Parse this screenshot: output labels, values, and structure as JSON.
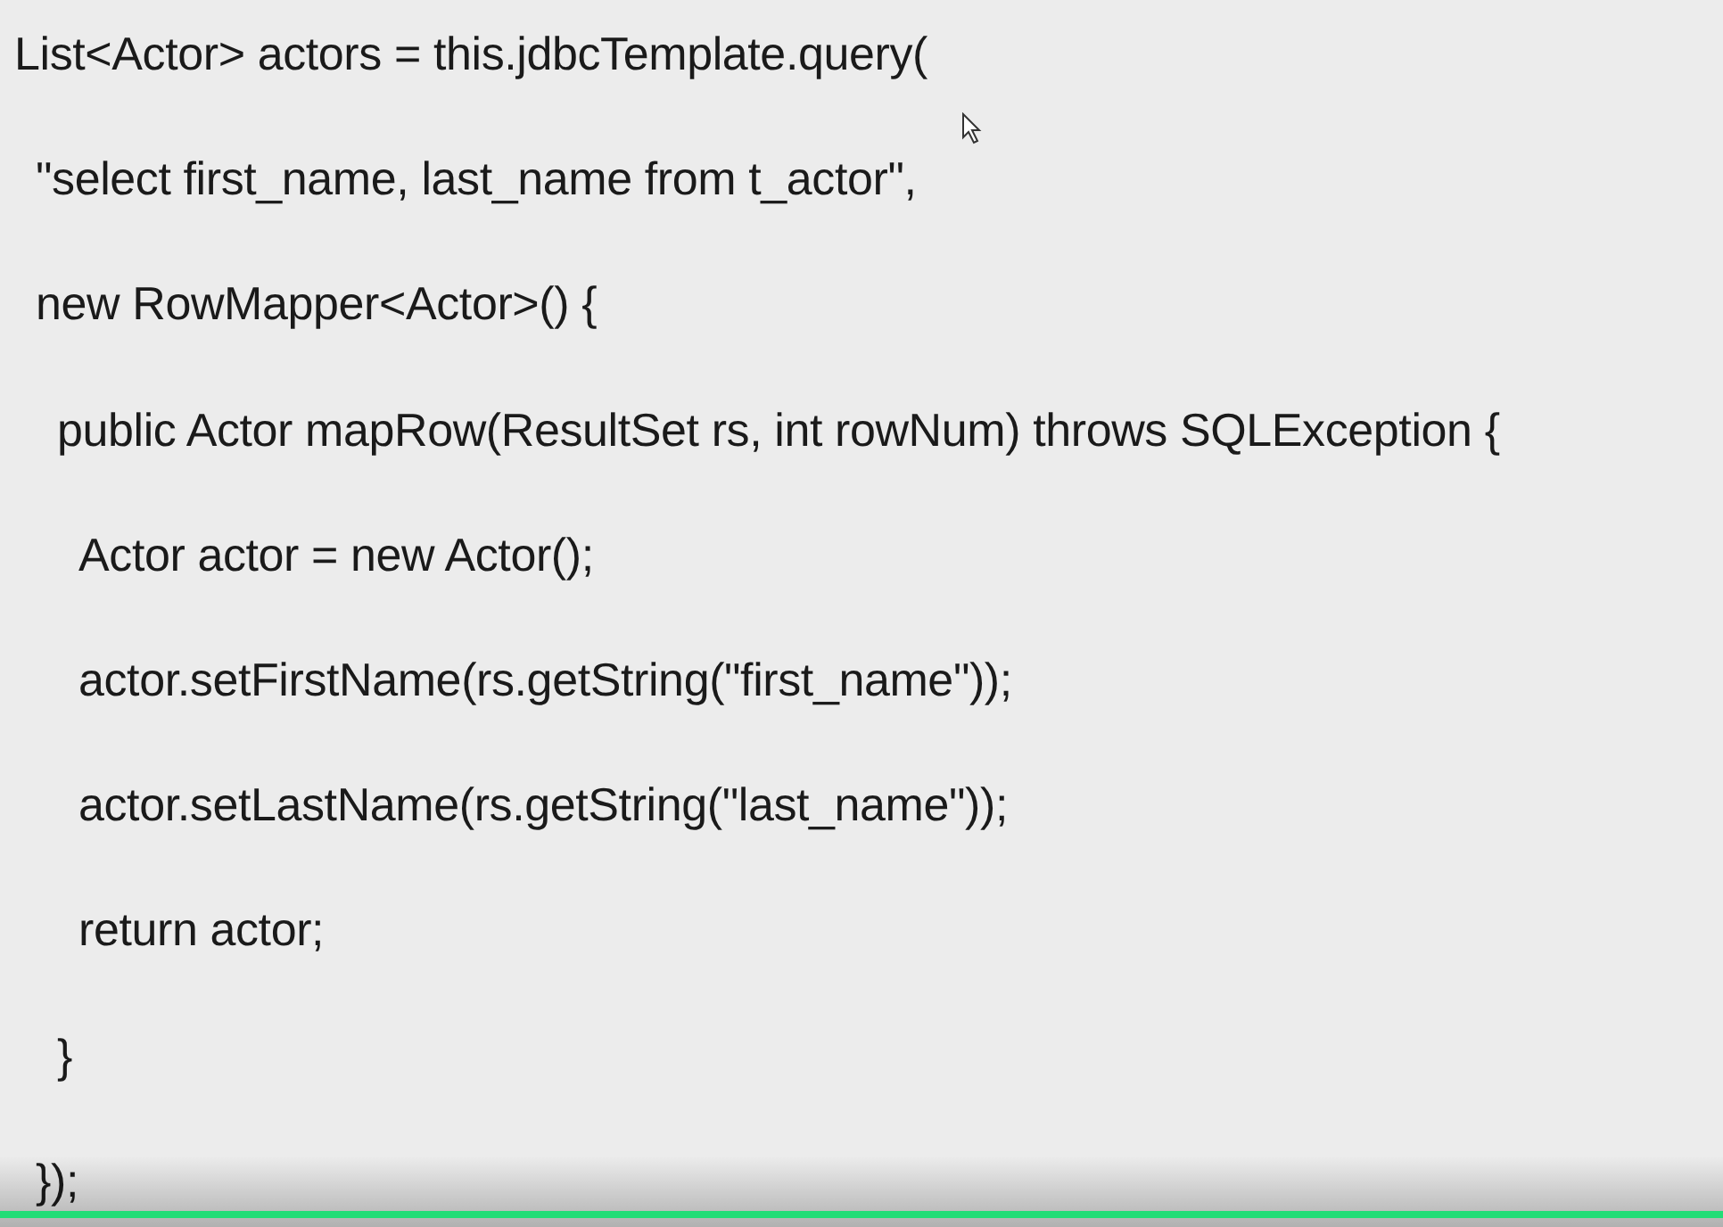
{
  "code": [
    {
      "text": "List<Actor> actors = this.jdbcTemplate.query(",
      "children": [
        {
          "text": "\"select first_name, last_name from t_actor\","
        },
        {
          "text": "new RowMapper<Actor>() {",
          "children": [
            {
              "text": "public Actor mapRow(ResultSet rs, int rowNum) throws SQLException {",
              "children": [
                {
                  "text": "Actor actor = new Actor();"
                },
                {
                  "text": "actor.setFirstName(rs.getString(\"first_name\"));"
                },
                {
                  "text": "actor.setLastName(rs.getString(\"last_name\"));"
                },
                {
                  "text": "return actor;"
                }
              ]
            },
            {
              "text": "}"
            }
          ]
        },
        {
          "text": "});"
        }
      ]
    }
  ]
}
